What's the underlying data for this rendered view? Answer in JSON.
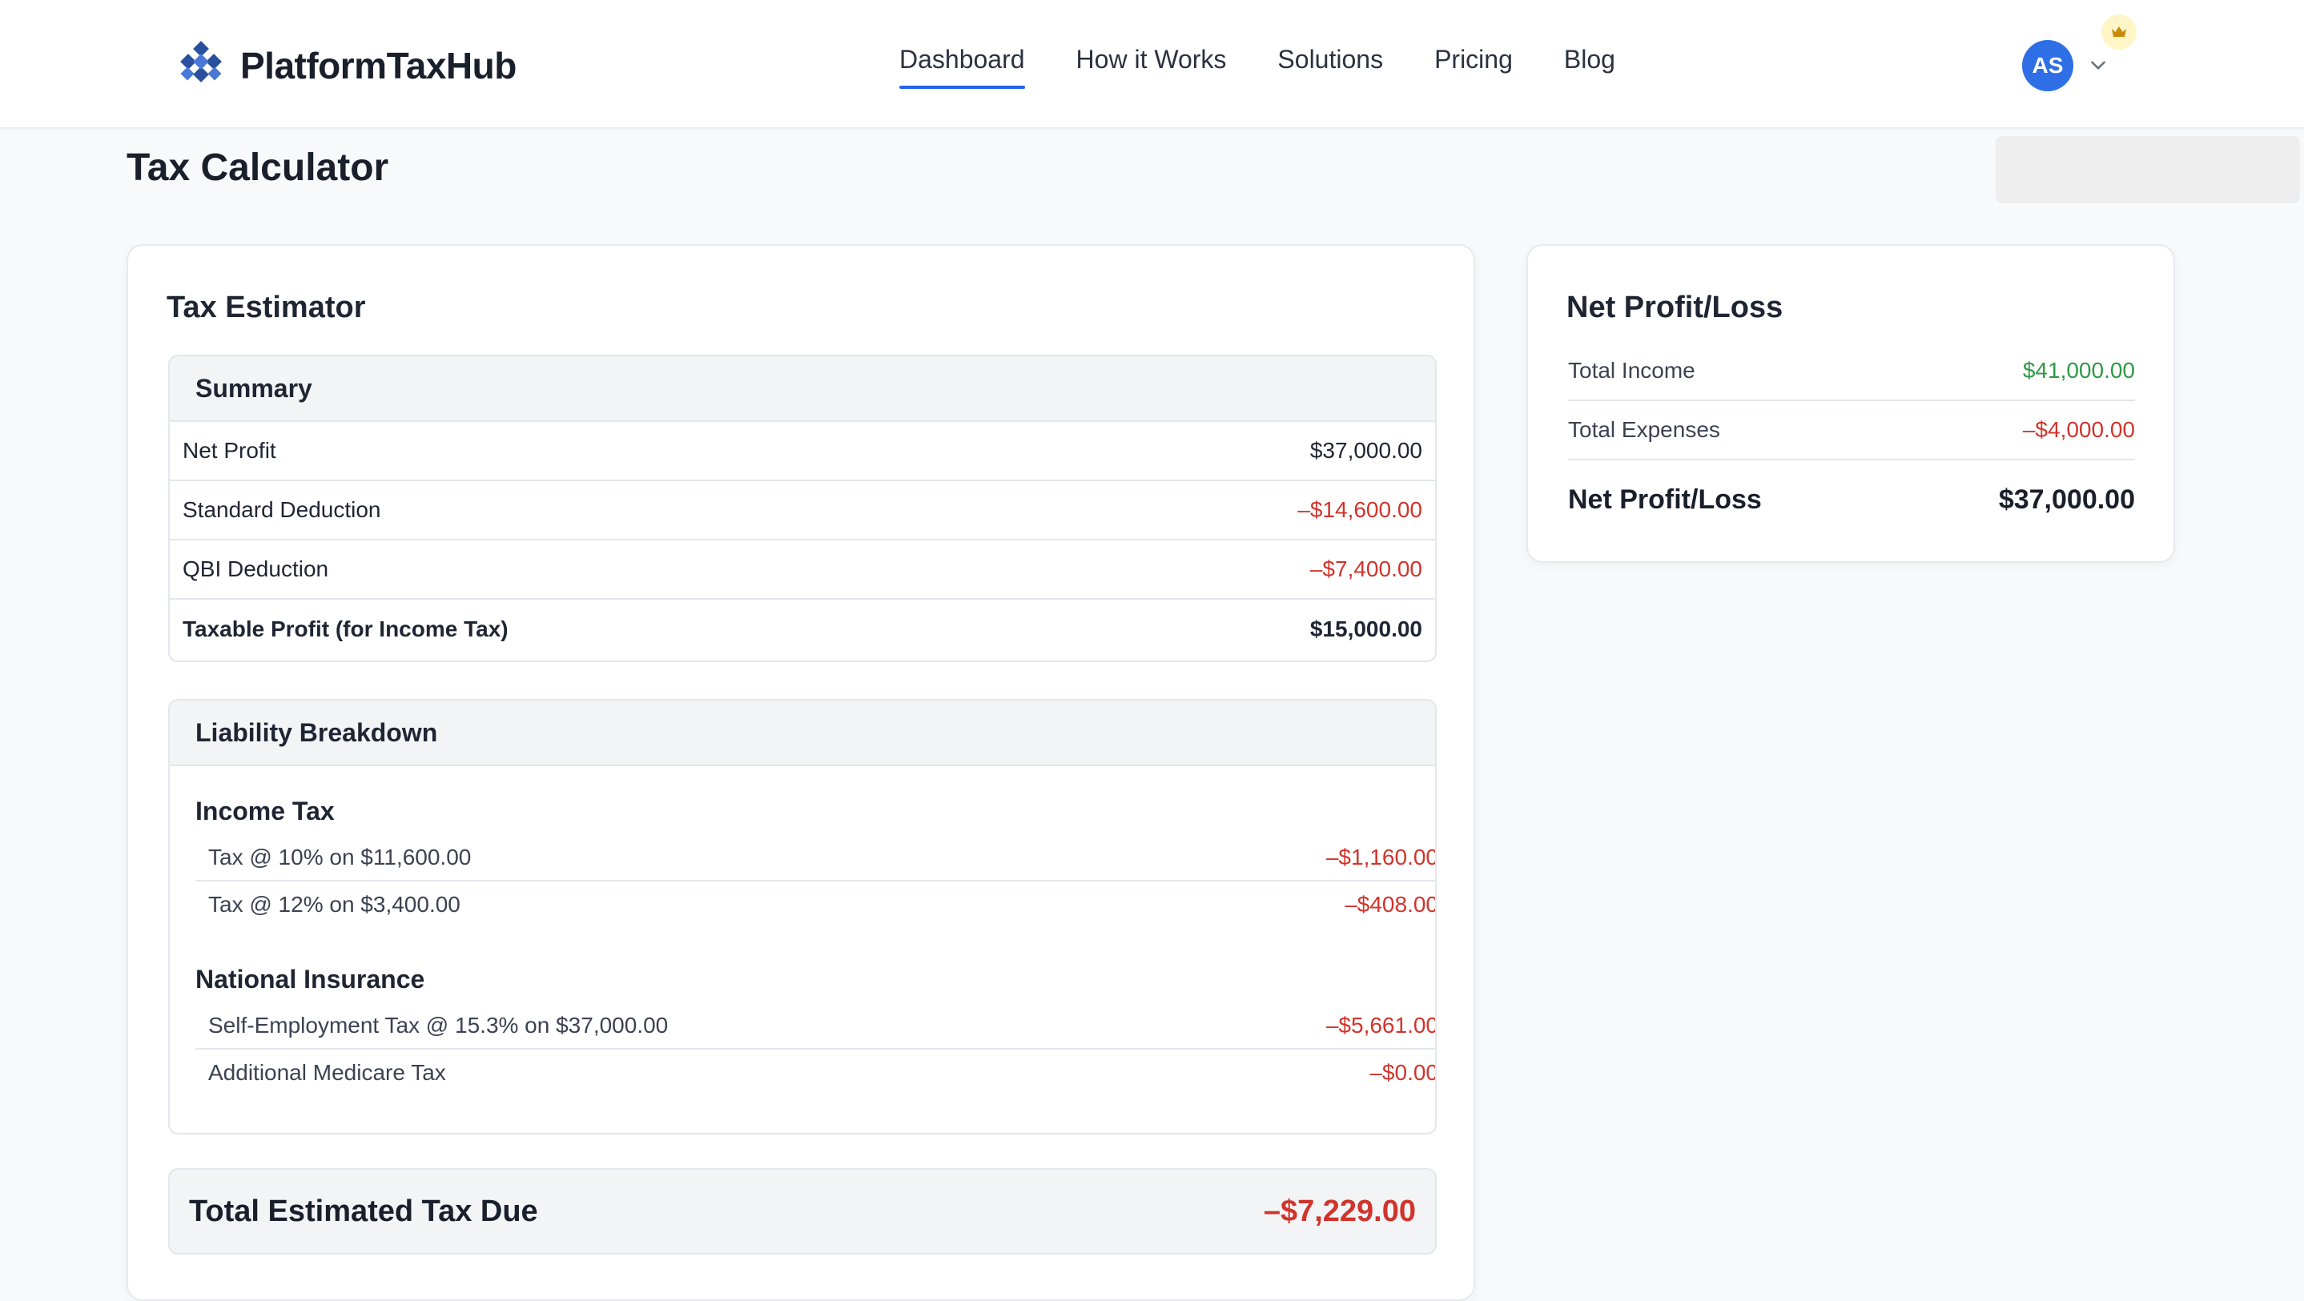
{
  "brand": {
    "name": "PlatformTaxHub"
  },
  "nav": {
    "items": [
      {
        "label": "Dashboard",
        "active": true
      },
      {
        "label": "How it Works",
        "active": false
      },
      {
        "label": "Solutions",
        "active": false
      },
      {
        "label": "Pricing",
        "active": false
      },
      {
        "label": "Blog",
        "active": false
      }
    ]
  },
  "user": {
    "initials": "AS"
  },
  "page": {
    "title": "Tax Calculator"
  },
  "estimator": {
    "title": "Tax Estimator",
    "summary": {
      "heading": "Summary",
      "rows": [
        {
          "label": "Net Profit",
          "value": "$37,000.00"
        },
        {
          "label": "Standard Deduction",
          "value": "–$14,600.00"
        },
        {
          "label": "QBI Deduction",
          "value": "–$7,400.00"
        },
        {
          "label": "Taxable Profit (for Income Tax)",
          "value": "$15,000.00"
        }
      ]
    },
    "liability": {
      "heading": "Liability Breakdown",
      "income_tax": {
        "title": "Income Tax",
        "rows": [
          {
            "label": "Tax @ 10% on $11,600.00",
            "value": "–$1,160.00"
          },
          {
            "label": "Tax @ 12% on $3,400.00",
            "value": "–$408.00"
          }
        ]
      },
      "national_insurance": {
        "title": "National Insurance",
        "rows": [
          {
            "label": "Self-Employment Tax @ 15.3% on $37,000.00",
            "value": "–$5,661.00"
          },
          {
            "label": "Additional Medicare Tax",
            "value": "–$0.00"
          }
        ]
      }
    },
    "total": {
      "label": "Total Estimated Tax Due",
      "value": "–$7,229.00"
    }
  },
  "net_profit": {
    "title": "Net Profit/Loss",
    "rows": [
      {
        "label": "Total Income",
        "value": "$41,000.00"
      },
      {
        "label": "Total Expenses",
        "value": "–$4,000.00"
      }
    ],
    "total": {
      "label": "Net Profit/Loss",
      "value": "$37,000.00"
    }
  },
  "colors": {
    "accent": "#2563eb",
    "negative": "#d0342c",
    "positive": "#2e9a45",
    "avatar": "#2f6fe6"
  },
  "icons": {
    "logo": "diamond-grid-logo-icon",
    "chevron": "chevron-down-icon",
    "crown": "crown-icon"
  }
}
